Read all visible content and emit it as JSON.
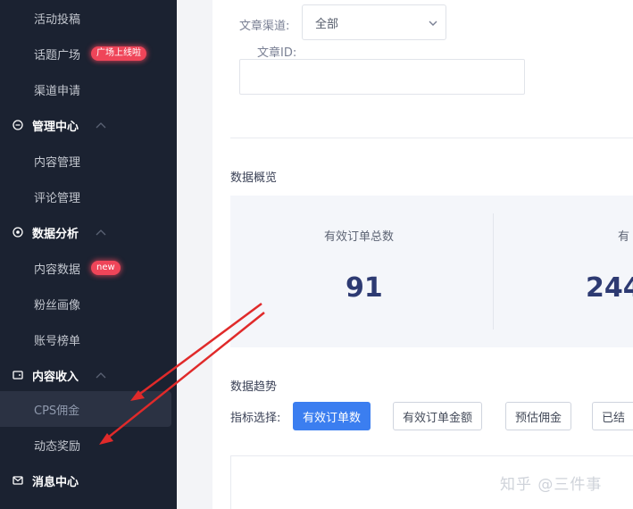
{
  "sidebar": {
    "items": [
      {
        "label": "活动投稿"
      },
      {
        "label": "话题广场",
        "badge": "广场上线啦"
      },
      {
        "label": "渠道申请"
      },
      {
        "label": "管理中心",
        "icon": "message-circle-icon"
      },
      {
        "label": "内容管理"
      },
      {
        "label": "评论管理"
      },
      {
        "label": "数据分析",
        "icon": "target-icon"
      },
      {
        "label": "内容数据",
        "badge": "new"
      },
      {
        "label": "粉丝画像"
      },
      {
        "label": "账号榜单"
      },
      {
        "label": "内容收入",
        "icon": "wallet-icon"
      },
      {
        "label": "CPS佣金"
      },
      {
        "label": "动态奖励"
      },
      {
        "label": "消息中心",
        "icon": "mail-icon"
      }
    ]
  },
  "filters": {
    "channel_label": "文章渠道:",
    "channel_value": "全部",
    "article_id_label": "文章ID:"
  },
  "overview": {
    "title": "数据概览",
    "metric1_label": "有效订单总数",
    "metric1_value": "91",
    "metric2_label_partial": "有",
    "metric2_value_partial": "244"
  },
  "trend": {
    "title": "数据趋势",
    "selector_label": "指标选择:",
    "buttons": [
      "有效订单数",
      "有效订单金额",
      "预估佣金",
      "已结"
    ]
  },
  "watermark": "知乎 @三件事",
  "colors": {
    "sidebar_bg": "#1b2231",
    "accent": "#3b7ef0",
    "badge": "#ef4559",
    "annotation_arrow": "#e02a2a",
    "value_text": "#2d3a72"
  }
}
